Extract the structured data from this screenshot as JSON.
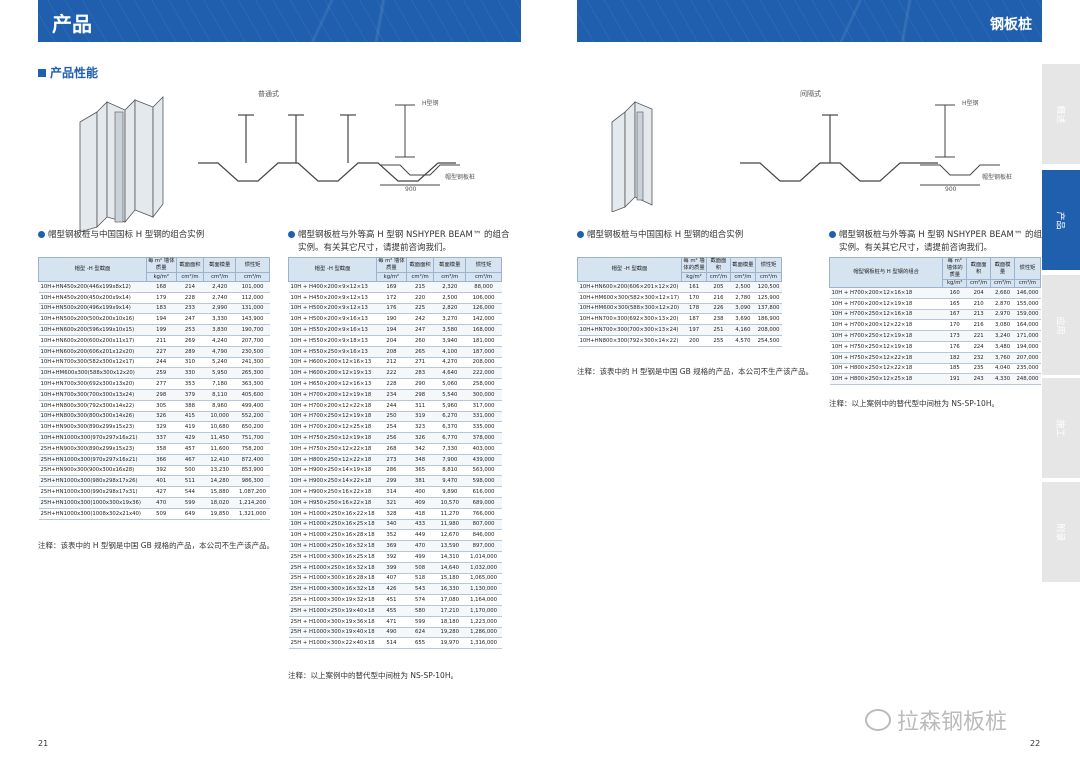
{
  "header": {
    "left_title": "产品",
    "right_title": "钢板桩"
  },
  "section": {
    "title": "产品性能"
  },
  "drawings": {
    "left_caption": "普通式",
    "right_caption": "间隔式",
    "h_label": "H型钢",
    "sheet_label": "帽型钢板桩",
    "dim": "900"
  },
  "tables": [
    {
      "title": "帽型钢板桩与中国国标 H 型钢的组合实例",
      "h1": "帽型 -H 型截面",
      "h2": "每 m² 墙体质量",
      "h3": "截面面积",
      "h4": "截面模量",
      "h5": "惯性矩",
      "u1": "kg/m²",
      "u2": "cm²/m",
      "u3": "cm³/m",
      "u4": "cm⁴/m",
      "rows": [
        [
          "10H+HN450x200(446x199x8x12)",
          "168",
          "214",
          "2,420",
          "101,000"
        ],
        [
          "10H+HN450x200(450x200x9x14)",
          "179",
          "228",
          "2,740",
          "112,000"
        ],
        [
          "10H+HN500x200(496x199x9x14)",
          "183",
          "233",
          "2,990",
          "131,000"
        ],
        [
          "10H+HN500x200(500x200x10x16)",
          "194",
          "247",
          "3,330",
          "143,900"
        ],
        [
          "10H+HN600x200(596x199x10x15)",
          "199",
          "253",
          "3,830",
          "190,700"
        ],
        [
          "10H+HN600x200(600x200x11x17)",
          "211",
          "269",
          "4,240",
          "207,700"
        ],
        [
          "10H+HN600x200(606x201x12x20)",
          "227",
          "289",
          "4,790",
          "230,500"
        ],
        [
          "10H+HN700x300(582x300x12x17)",
          "244",
          "310",
          "5,240",
          "241,300"
        ],
        [
          "10H+HM600x300(588x300x12x20)",
          "259",
          "330",
          "5,950",
          "265,300"
        ],
        [
          "10H+HN700x300(692x300x13x20)",
          "277",
          "353",
          "7,180",
          "363,300"
        ],
        [
          "10H+HN700x300(700x300x13x24)",
          "298",
          "379",
          "8,110",
          "405,600"
        ],
        [
          "10H+HN800x300(792x300x14x22)",
          "305",
          "388",
          "8,960",
          "499,400"
        ],
        [
          "10H+HN800x300(800x300x14x26)",
          "326",
          "415",
          "10,000",
          "552,200"
        ],
        [
          "10H+HN900x300(890x299x15x23)",
          "329",
          "419",
          "10,680",
          "650,200"
        ],
        [
          "10H+HN1000x300(970x297x16x21)",
          "337",
          "429",
          "11,450",
          "751,700"
        ],
        [
          "25H+HN900x300(890x299x15x23)",
          "358",
          "457",
          "11,600",
          "758,200"
        ],
        [
          "25H+HN1000x300(970x297x16x21)",
          "366",
          "467",
          "12,410",
          "872,400"
        ],
        [
          "25H+HN900x300(900x300x16x28)",
          "392",
          "500",
          "13,230",
          "853,900"
        ],
        [
          "25H+HN1000x300(980x298x17x26)",
          "401",
          "511",
          "14,280",
          "986,300"
        ],
        [
          "25H+HN1000x300(990x298x17x31)",
          "427",
          "544",
          "15,880",
          "1,087,200"
        ],
        [
          "25H+HN1000x300(1000x300x19x36)",
          "470",
          "599",
          "18,020",
          "1,214,200"
        ],
        [
          "25H+HN1000x300(1008x302x21x40)",
          "509",
          "649",
          "19,850",
          "1,321,000"
        ]
      ],
      "note": "注释：该表中的 H 型钢是中国 GB 规格的产品，本公司不生产该产品。"
    },
    {
      "title1": "帽型钢板桩与外等高 H 型钢 NSHYPER BEAM™ 的组合",
      "title2": "实例。有关其它尺寸，请提前咨询我们。",
      "h1": "帽型 -H 型截面",
      "h2": "每 m² 墙体质量",
      "h3": "截面面积",
      "h4": "截面模量",
      "h5": "惯性矩",
      "u1": "kg/m²",
      "u2": "cm²/m",
      "u3": "cm³/m",
      "u4": "cm⁴/m",
      "rows": [
        [
          "10H + H400×200×9×12×13",
          "169",
          "215",
          "2,320",
          "88,000"
        ],
        [
          "10H + H450×200×9×12×13",
          "172",
          "220",
          "2,500",
          "106,000"
        ],
        [
          "10H + H500×200×9×12×13",
          "176",
          "225",
          "2,820",
          "126,000"
        ],
        [
          "10H + H500×200×9×16×13",
          "190",
          "242",
          "3,270",
          "142,000"
        ],
        [
          "10H + H550×200×9×16×13",
          "194",
          "247",
          "3,580",
          "168,000"
        ],
        [
          "10H + H550×200×9×18×13",
          "204",
          "260",
          "3,940",
          "181,000"
        ],
        [
          "10H + H550×250×9×16×13",
          "208",
          "265",
          "4,100",
          "187,000"
        ],
        [
          "10H + H600×200×12×16×13",
          "212",
          "271",
          "4,270",
          "208,000"
        ],
        [
          "10H + H600×200×12×19×13",
          "222",
          "283",
          "4,640",
          "222,000"
        ],
        [
          "10H + H650×200×12×16×13",
          "228",
          "290",
          "5,060",
          "258,000"
        ],
        [
          "10H + H700×200×12×19×18",
          "234",
          "298",
          "5,540",
          "300,000"
        ],
        [
          "10H + H700×200×12×22×18",
          "244",
          "311",
          "5,960",
          "317,000"
        ],
        [
          "10H + H700×250×12×19×18",
          "250",
          "319",
          "6,270",
          "331,000"
        ],
        [
          "10H + H700×200×12×25×18",
          "254",
          "323",
          "6,370",
          "335,000"
        ],
        [
          "10H + H750×250×12×19×18",
          "256",
          "326",
          "6,770",
          "378,000"
        ],
        [
          "10H + H750×250×12×22×18",
          "268",
          "342",
          "7,330",
          "403,000"
        ],
        [
          "10H + H800×250×12×22×18",
          "273",
          "348",
          "7,900",
          "439,000"
        ],
        [
          "10H + H900×250×14×19×18",
          "286",
          "365",
          "8,810",
          "563,000"
        ],
        [
          "10H + H900×250×14×22×18",
          "299",
          "381",
          "9,470",
          "598,000"
        ],
        [
          "10H + H900×250×16×22×18",
          "314",
          "400",
          "9,890",
          "616,000"
        ],
        [
          "10H + H950×250×16×22×18",
          "321",
          "409",
          "10,570",
          "689,000"
        ],
        [
          "10H + H1000×250×16×22×18",
          "328",
          "418",
          "11,270",
          "766,000"
        ],
        [
          "10H + H1000×250×16×25×18",
          "340",
          "433",
          "11,980",
          "807,000"
        ],
        [
          "10H + H1000×250×16×28×18",
          "352",
          "449",
          "12,670",
          "846,000"
        ],
        [
          "10H + H1000×250×16×32×18",
          "369",
          "470",
          "13,590",
          "897,000"
        ],
        [
          "25H + H1000×300×16×25×18",
          "392",
          "499",
          "14,310",
          "1,014,000"
        ],
        [
          "25H + H1000×250×16×32×18",
          "399",
          "508",
          "14,640",
          "1,032,000"
        ],
        [
          "25H + H1000×300×16×28×18",
          "407",
          "518",
          "15,180",
          "1,065,000"
        ],
        [
          "25H + H1000×300×16×32×18",
          "426",
          "543",
          "16,330",
          "1,130,000"
        ],
        [
          "25H + H1000×300×19×32×18",
          "451",
          "574",
          "17,080",
          "1,164,000"
        ],
        [
          "25H + H1000×250×19×40×18",
          "455",
          "580",
          "17,210",
          "1,170,000"
        ],
        [
          "25H + H1000×300×19×36×18",
          "471",
          "599",
          "18,180",
          "1,223,000"
        ],
        [
          "25H + H1000×300×19×40×18",
          "490",
          "624",
          "19,280",
          "1,286,000"
        ],
        [
          "25H + H1000×300×22×40×18",
          "514",
          "655",
          "19,970",
          "1,316,000"
        ]
      ],
      "note": "注释：以上案例中的替代型中间桩为 NS-SP-10H。"
    },
    {
      "title": "帽型钢板桩与中国国标 H 型钢的组合实例",
      "h1": "帽型 -H 型截面",
      "h2": "每 m² 墙体的质量",
      "h3": "截面面积",
      "h4": "截面模量",
      "h5": "惯性矩",
      "u1": "kg/m²",
      "u2": "cm²/m",
      "u3": "cm³/m",
      "u4": "cm⁴/m",
      "rows": [
        [
          "10H+HN600×200(606×201×12×20)",
          "161",
          "205",
          "2,500",
          "120,500"
        ],
        [
          "10H+HM600×300(582×300×12×17)",
          "170",
          "216",
          "2,780",
          "125,900"
        ],
        [
          "10H+HM600×300(588×300×12×20)",
          "178",
          "226",
          "3,090",
          "137,800"
        ],
        [
          "10H+HN700×300(692×300×13×20)",
          "187",
          "238",
          "3,690",
          "186,900"
        ],
        [
          "10H+HN700×300(700×300×13×24)",
          "197",
          "251",
          "4,160",
          "208,000"
        ],
        [
          "10H+HN800×300(792×300×14×22)",
          "200",
          "255",
          "4,570",
          "254,500"
        ]
      ],
      "note": "注释：该表中的 H 型钢是中国 GB 规格的产品，本公司不生产该产品。"
    },
    {
      "title1": "帽型钢板桩与外等高 H 型钢 NSHYPER BEAM™ 的组合",
      "title2": "实例。有关其它尺寸，请提前咨询我们。",
      "h1": "帽型钢板桩与 H 型钢的组合",
      "h2": "每 m² 墙体的质量",
      "h3": "截面面积",
      "h4": "截面模量",
      "h5": "惯性矩",
      "u1": "kg/m²",
      "u2": "cm²/m",
      "u3": "cm³/m",
      "u4": "cm⁴/m",
      "rows": [
        [
          "10H + H700×200×12×16×18",
          "160",
          "204",
          "2,660",
          "146,000"
        ],
        [
          "10H + H700×200×12×19×18",
          "165",
          "210",
          "2,870",
          "155,000"
        ],
        [
          "10H + H700×250×12×16×18",
          "167",
          "213",
          "2,970",
          "159,000"
        ],
        [
          "10H + H700×200×12×22×18",
          "170",
          "216",
          "3,080",
          "164,000"
        ],
        [
          "10H + H700×250×12×19×18",
          "173",
          "221",
          "3,240",
          "171,000"
        ],
        [
          "10H + H750×250×12×19×18",
          "176",
          "224",
          "3,480",
          "194,000"
        ],
        [
          "10H + H750×250×12×22×18",
          "182",
          "232",
          "3,760",
          "207,000"
        ],
        [
          "10H + H800×250×12×22×18",
          "185",
          "235",
          "4,040",
          "235,000"
        ],
        [
          "10H + H800×250×12×25×18",
          "191",
          "243",
          "4,330",
          "248,000"
        ]
      ],
      "note": "注释：以上案例中的替代型中间桩为 NS-SP-10H。"
    }
  ],
  "sidebar": [
    "概述",
    "产品",
    "应用",
    "施工",
    "附录"
  ],
  "pages": {
    "left": "21",
    "right": "22"
  },
  "watermark": "拉森钢板桩"
}
